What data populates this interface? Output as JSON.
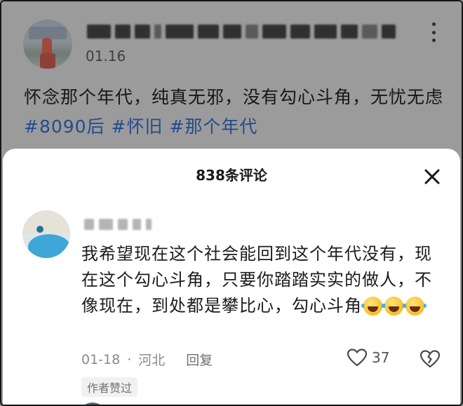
{
  "post": {
    "date": "01.16",
    "text_plain": "怀念那个年代，纯真无邪，没有勾心斗角，无忧无虑",
    "tags": [
      "#8090后",
      "#怀旧",
      "#那个年代"
    ]
  },
  "sheet": {
    "title": "838条评论"
  },
  "comment": {
    "text": "我希望现在这个社会能回到这个年代没有，现在这个勾心斗角，只要你踏踏实实的做人，不像现在，到处都是攀比心，勾心斗角",
    "emoji_count": 3,
    "date": "01-18",
    "dot": "·",
    "location": "河北",
    "reply_label": "回复",
    "like_count": "37",
    "author_badge": "作者赞过"
  },
  "colors": {
    "tag": "#234b8e",
    "dim_background": "#9b9b9b",
    "sheet_background": "#ffffff"
  },
  "icons": {
    "more": "more-vertical-icon",
    "close": "close-icon",
    "like": "heart-icon",
    "dislike": "broken-heart-icon",
    "emoji": "rolling-on-floor-laughing-emoji"
  }
}
